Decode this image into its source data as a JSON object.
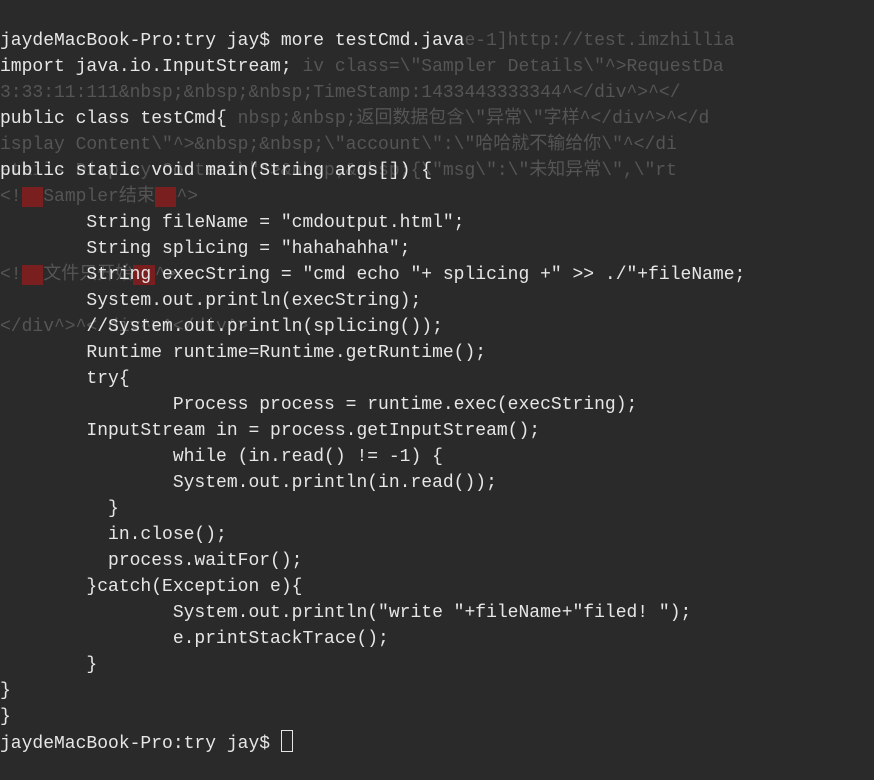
{
  "ghost": {
    "l0_tail": "e-1]http://test.imzhillia",
    "l1_tail": "iv class=\\\"Sampler Details\\\"^>RequestDa",
    "l2": "3:33:11:111&nbsp;&nbsp;&nbsp;TimeStamp:1433443333344^</div^>^</",
    "l3_tail": "nbsp;&nbsp;返回数据包含\\\"异常\\\"字样^</div^>^</d",
    "l4": "isplay Content\\\"^>&nbsp;&nbsp;\\\"account\\\":\\\"哈哈就不输给你\\\"^</di",
    "l5_a": "etails Display Content\\\"^>&nbsp;&nbsp;{\\\"msg\\\":\\\"未知异常\\\",\\\"rt",
    "l6": "<!",
    "l6_red": "——",
    "l6_b": "Sampler结束",
    "l6_red2": "——",
    "l6_c": "^>",
    "l9": "<!",
    "l9_red": "——",
    "l9_b": "文件只开始",
    "l9_red2": "——",
    "l9_c": "^>",
    "l11": "</div^>^</div^>^</div^>"
  },
  "code": {
    "l0": "jaydeMacBook-Pro:try jay$ more testCmd.java",
    "l1": "import java.io.InputStream;",
    "l2": "",
    "l3": "public class testCmd{",
    "l4": "",
    "l5": "public static void main(String args[]) {",
    "l6": "",
    "l7": "        String fileName = \"cmdoutput.html\";",
    "l8": "        String splicing = \"hahahahha\";",
    "l9": "        String execString = \"cmd echo \"+ splicing +\" >> ./\"+fileName;",
    "l10": "        System.out.println(execString);",
    "l11": "        //System.out.println(splicing());",
    "l12": "        Runtime runtime=Runtime.getRuntime();",
    "l13": "        try{",
    "l14": "                Process process = runtime.exec(execString);",
    "l15": "        InputStream in = process.getInputStream();",
    "l16": "                while (in.read() != -1) {",
    "l17": "                System.out.println(in.read());",
    "l18": "          }",
    "l19": "          in.close();",
    "l20": "          process.waitFor();",
    "l21": "        }catch(Exception e){",
    "l22": "                System.out.println(\"write \"+fileName+\"filed! \");",
    "l23": "                e.printStackTrace();",
    "l24": "        }",
    "l25": "}",
    "l26": "}",
    "l27": "jaydeMacBook-Pro:try jay$ "
  }
}
